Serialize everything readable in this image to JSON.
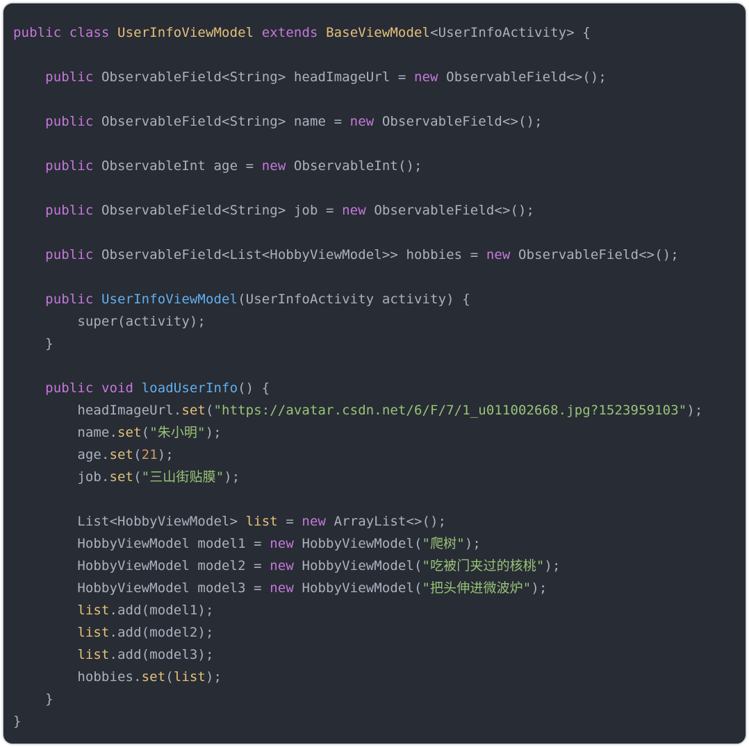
{
  "editor": {
    "language": "java",
    "theme": "one-dark",
    "background_color": "#282c34",
    "border_color": "#b8bcc4",
    "default_text_color": "#abb2bf",
    "token_colors": {
      "keyword": "#c678dd",
      "type": "#e5c07b",
      "method_declaration": "#61afef",
      "method_call": "#e5c07b",
      "string": "#98c379",
      "number": "#d19a66",
      "variable": "#e5c07b",
      "plain": "#abb2bf"
    }
  },
  "code": {
    "class_name": "UserInfoViewModel",
    "super_class": "BaseViewModel",
    "type_parameter": "UserInfoActivity",
    "lines": [
      {
        "n": 1,
        "indent": 0,
        "text": "public class UserInfoViewModel extends BaseViewModel<UserInfoActivity> {"
      },
      {
        "n": 2,
        "indent": 0,
        "text": ""
      },
      {
        "n": 3,
        "indent": 1,
        "text": "public ObservableField<String> headImageUrl = new ObservableField<>();"
      },
      {
        "n": 4,
        "indent": 0,
        "text": ""
      },
      {
        "n": 5,
        "indent": 1,
        "text": "public ObservableField<String> name = new ObservableField<>();"
      },
      {
        "n": 6,
        "indent": 0,
        "text": ""
      },
      {
        "n": 7,
        "indent": 1,
        "text": "public ObservableInt age = new ObservableInt();"
      },
      {
        "n": 8,
        "indent": 0,
        "text": ""
      },
      {
        "n": 9,
        "indent": 1,
        "text": "public ObservableField<String> job = new ObservableField<>();"
      },
      {
        "n": 10,
        "indent": 0,
        "text": ""
      },
      {
        "n": 11,
        "indent": 1,
        "text": "public ObservableField<List<HobbyViewModel>> hobbies = new ObservableField<>();"
      },
      {
        "n": 12,
        "indent": 0,
        "text": ""
      },
      {
        "n": 13,
        "indent": 1,
        "text": "public UserInfoViewModel(UserInfoActivity activity) {"
      },
      {
        "n": 14,
        "indent": 2,
        "text": "super(activity);"
      },
      {
        "n": 15,
        "indent": 1,
        "text": "}"
      },
      {
        "n": 16,
        "indent": 0,
        "text": ""
      },
      {
        "n": 17,
        "indent": 1,
        "text": "public void loadUserInfo() {"
      },
      {
        "n": 18,
        "indent": 2,
        "text": "headImageUrl.set(\"https://avatar.csdn.net/6/F/7/1_u011002668.jpg?1523959103\");"
      },
      {
        "n": 19,
        "indent": 2,
        "text": "name.set(\"朱小明\");"
      },
      {
        "n": 20,
        "indent": 2,
        "text": "age.set(21);"
      },
      {
        "n": 21,
        "indent": 2,
        "text": "job.set(\"三山街贴膜\");"
      },
      {
        "n": 22,
        "indent": 0,
        "text": ""
      },
      {
        "n": 23,
        "indent": 2,
        "text": "List<HobbyViewModel> list = new ArrayList<>();"
      },
      {
        "n": 24,
        "indent": 2,
        "text": "HobbyViewModel model1 = new HobbyViewModel(\"爬树\");"
      },
      {
        "n": 25,
        "indent": 2,
        "text": "HobbyViewModel model2 = new HobbyViewModel(\"吃被门夹过的核桃\");"
      },
      {
        "n": 26,
        "indent": 2,
        "text": "HobbyViewModel model3 = new HobbyViewModel(\"把头伸进微波炉\");"
      },
      {
        "n": 27,
        "indent": 2,
        "text": "list.add(model1);"
      },
      {
        "n": 28,
        "indent": 2,
        "text": "list.add(model2);"
      },
      {
        "n": 29,
        "indent": 2,
        "text": "list.add(model3);"
      },
      {
        "n": 30,
        "indent": 2,
        "text": "hobbies.set(list);"
      },
      {
        "n": 31,
        "indent": 1,
        "text": "}"
      },
      {
        "n": 32,
        "indent": 0,
        "text": "}"
      }
    ],
    "string_literals": [
      "https://avatar.csdn.net/6/F/7/1_u011002668.jpg?1523959103",
      "朱小明",
      "三山街贴膜",
      "爬树",
      "吃被门夹过的核桃",
      "把头伸进微波炉"
    ],
    "numeric_literals": [
      "21"
    ],
    "fields": [
      {
        "modifier": "public",
        "type": "ObservableField<String>",
        "name": "headImageUrl"
      },
      {
        "modifier": "public",
        "type": "ObservableField<String>",
        "name": "name"
      },
      {
        "modifier": "public",
        "type": "ObservableInt",
        "name": "age"
      },
      {
        "modifier": "public",
        "type": "ObservableField<String>",
        "name": "job"
      },
      {
        "modifier": "public",
        "type": "ObservableField<List<HobbyViewModel>>",
        "name": "hobbies"
      }
    ],
    "methods": [
      {
        "modifier": "public",
        "return_type": "",
        "name": "UserInfoViewModel",
        "params": "UserInfoActivity activity"
      },
      {
        "modifier": "public",
        "return_type": "void",
        "name": "loadUserInfo",
        "params": ""
      }
    ]
  }
}
